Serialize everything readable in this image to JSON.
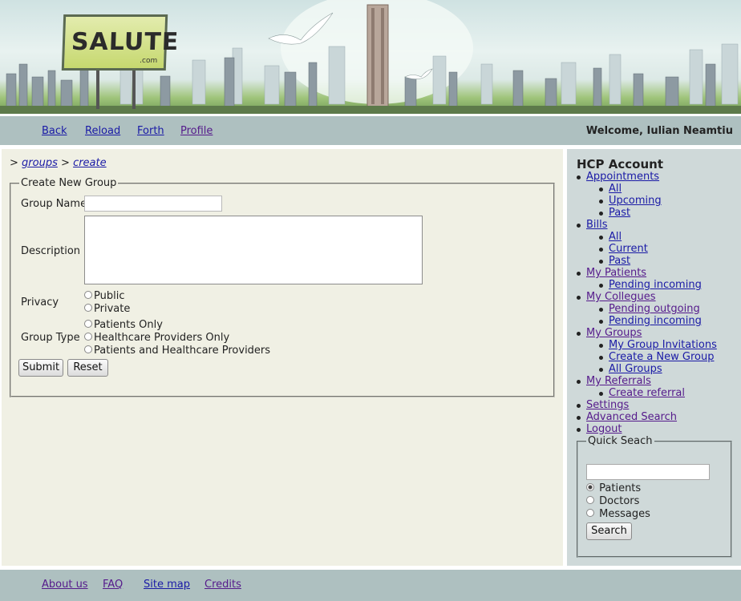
{
  "banner": {
    "logo_text": "SALUTE",
    "logo_sub": ".com"
  },
  "nav": {
    "links": [
      "Back",
      "Reload",
      "Forth",
      "Profile"
    ],
    "welcome": "Welcome, Iulian Neamtiu"
  },
  "breadcrumb": {
    "prefix1": ">",
    "link1": "groups",
    "prefix2": ">",
    "link2": "create"
  },
  "form": {
    "legend": "Create New Group",
    "group_name_label": "Group Name",
    "group_name_value": "",
    "description_label": "Description",
    "description_value": "",
    "privacy_label": "Privacy",
    "privacy_options": [
      "Public",
      "Private"
    ],
    "group_type_label": "Group Type",
    "group_type_options": [
      "Patients Only",
      "Healthcare Providers Only",
      "Patients and Healthcare Providers"
    ],
    "submit_label": "Submit",
    "reset_label": "Reset"
  },
  "sidebar": {
    "title": "HCP Account",
    "menu": {
      "appointments": "Appointments",
      "appt_all": "All",
      "appt_upcoming": "Upcoming",
      "appt_past": "Past",
      "bills": "Bills",
      "bills_all": "All",
      "bills_current": "Current",
      "bills_past": "Past",
      "my_patients": "My Patients",
      "pending_incoming_patients": "Pending incoming",
      "my_collegues": "My Collegues",
      "pending_outgoing": "Pending outgoing",
      "pending_incoming_collegues": "Pending incoming",
      "my_groups": "My Groups",
      "my_group_invitations": "My Group Invitations",
      "create_group": "Create a New Group",
      "all_groups": "All Groups",
      "my_referrals": "My Referrals",
      "create_referral": "Create referral",
      "settings": "Settings",
      "advanced_search": "Advanced Search",
      "logout": "Logout"
    },
    "quick_search": {
      "legend": "Quick Seach",
      "input_value": "",
      "options": [
        "Patients",
        "Doctors",
        "Messages"
      ],
      "selected": "Patients",
      "button_label": "Search"
    }
  },
  "footer": {
    "links": [
      "About us",
      "FAQ",
      "Site map",
      "Credits"
    ]
  },
  "colors": {
    "navbar": "#aec0c0",
    "main_bg": "#f0f0e4",
    "sidebar_bg": "#cfd9d9",
    "link": "#1a1aa6",
    "visited": "#551a8b"
  }
}
